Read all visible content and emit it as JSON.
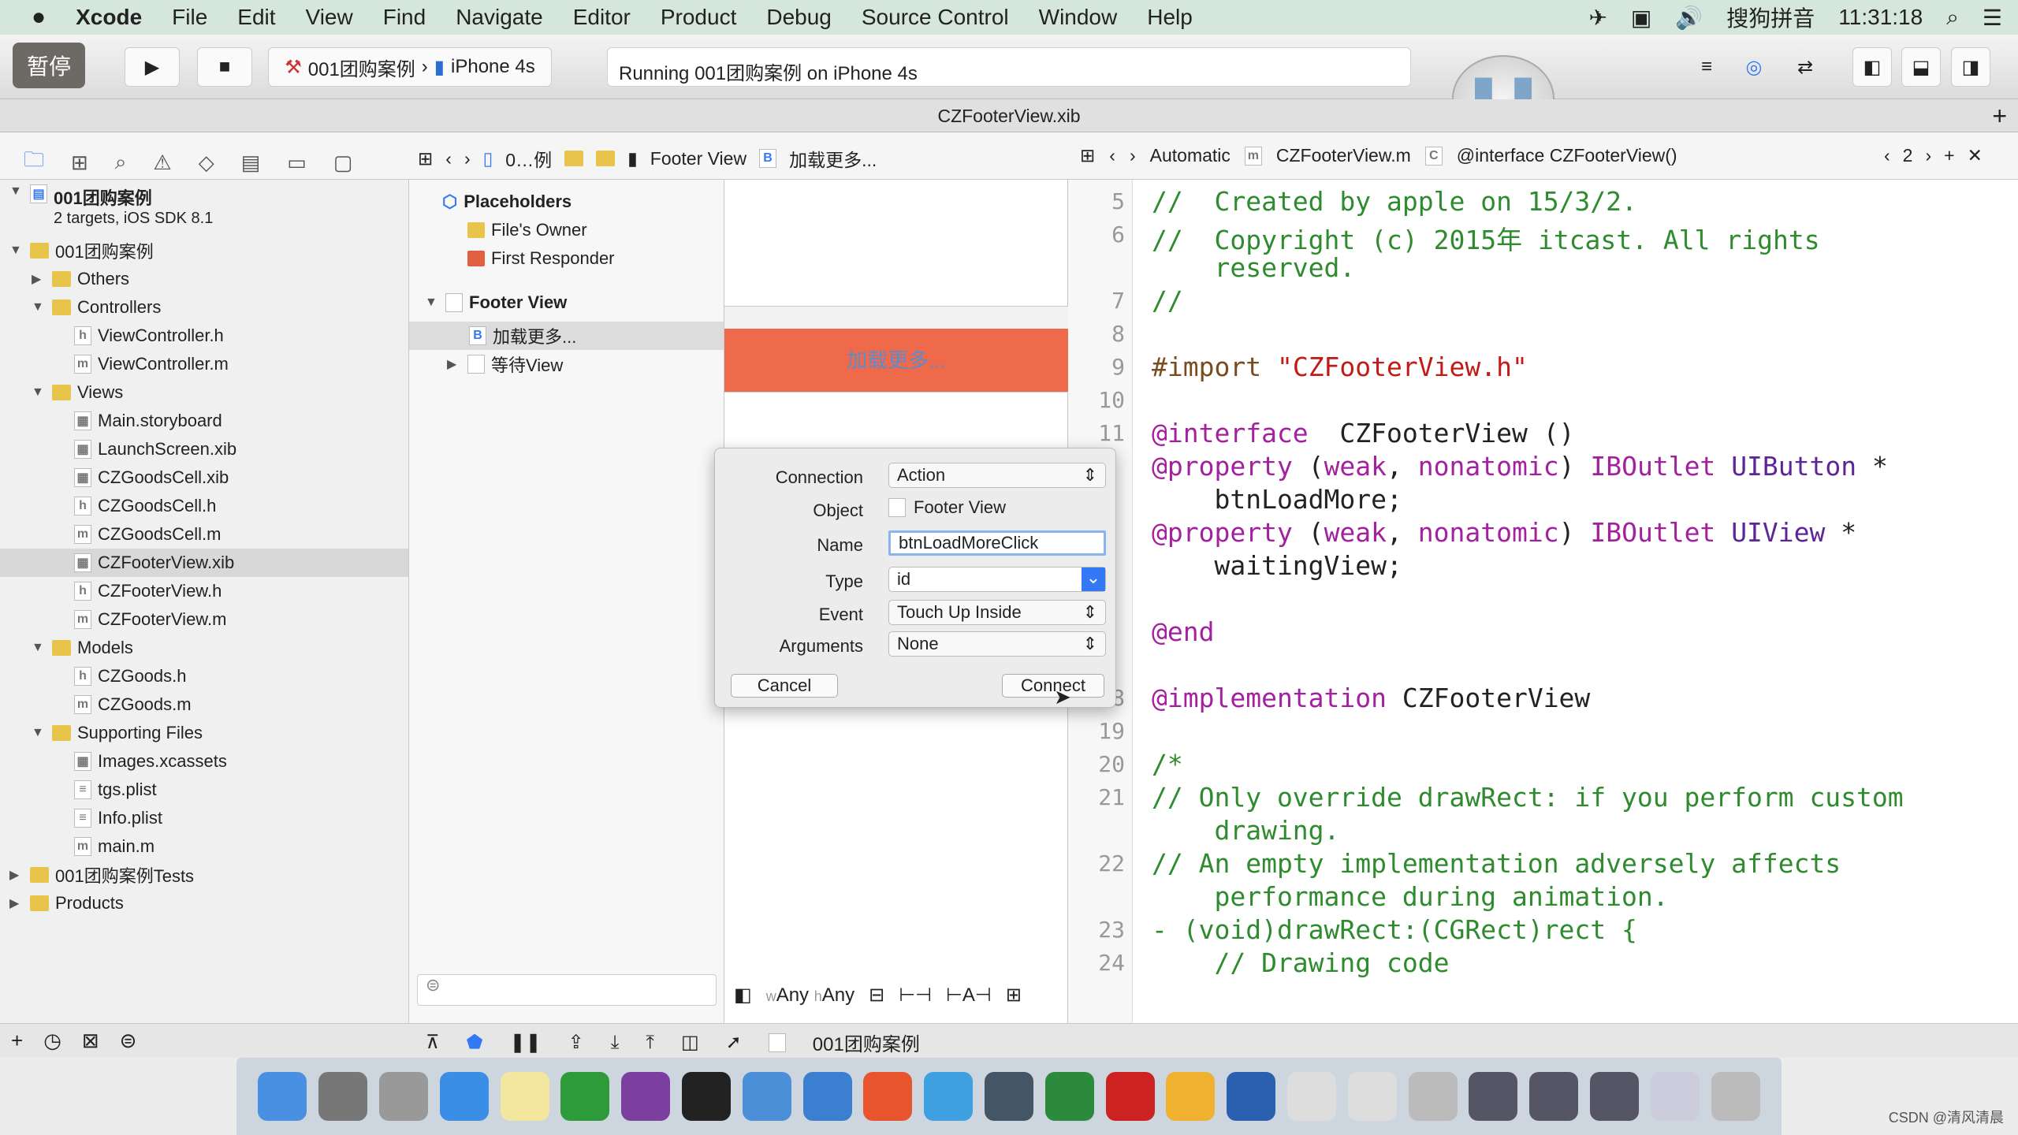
{
  "menubar": {
    "apple": "",
    "items": [
      "Xcode",
      "File",
      "Edit",
      "View",
      "Find",
      "Navigate",
      "Editor",
      "Product",
      "Debug",
      "Source Control",
      "Window",
      "Help"
    ],
    "input_method": "搜狗拼音",
    "clock": "11:31:18"
  },
  "toolbar": {
    "pause_badge": "暂停",
    "scheme": "001团购案例",
    "device": "iPhone 4s",
    "status": "Running 001团购案例 on iPhone 4s"
  },
  "tab": {
    "title": "CZFooterView.xib"
  },
  "jumpbar": {
    "crumbs": [
      "0…例",
      "Footer View",
      "加载更多..."
    ],
    "editor_mode": "Automatic",
    "file": "CZFooterView.m",
    "symbol": "@interface CZFooterView()",
    "counterpart_count": "2"
  },
  "navigator": {
    "project": "001团购案例",
    "project_sub": "2 targets, iOS SDK 8.1",
    "rows": [
      {
        "label": "001团购案例",
        "level": 1,
        "kind": "folder",
        "open": true
      },
      {
        "label": "Others",
        "level": 2,
        "kind": "folder",
        "open": false
      },
      {
        "label": "Controllers",
        "level": 2,
        "kind": "folder",
        "open": true
      },
      {
        "label": "ViewController.h",
        "level": 3,
        "kind": "h"
      },
      {
        "label": "ViewController.m",
        "level": 3,
        "kind": "m"
      },
      {
        "label": "Views",
        "level": 2,
        "kind": "folder",
        "open": true
      },
      {
        "label": "Main.storyboard",
        "level": 3,
        "kind": "sb"
      },
      {
        "label": "LaunchScreen.xib",
        "level": 3,
        "kind": "xib"
      },
      {
        "label": "CZGoodsCell.xib",
        "level": 3,
        "kind": "xib"
      },
      {
        "label": "CZGoodsCell.h",
        "level": 3,
        "kind": "h"
      },
      {
        "label": "CZGoodsCell.m",
        "level": 3,
        "kind": "m"
      },
      {
        "label": "CZFooterView.xib",
        "level": 3,
        "kind": "xib",
        "selected": true
      },
      {
        "label": "CZFooterView.h",
        "level": 3,
        "kind": "h"
      },
      {
        "label": "CZFooterView.m",
        "level": 3,
        "kind": "m"
      },
      {
        "label": "Models",
        "level": 2,
        "kind": "folder",
        "open": true
      },
      {
        "label": "CZGoods.h",
        "level": 3,
        "kind": "h"
      },
      {
        "label": "CZGoods.m",
        "level": 3,
        "kind": "m"
      },
      {
        "label": "Supporting Files",
        "level": 2,
        "kind": "folder",
        "open": true
      },
      {
        "label": "Images.xcassets",
        "level": 3,
        "kind": "xib"
      },
      {
        "label": "tgs.plist",
        "level": 3,
        "kind": "plist"
      },
      {
        "label": "Info.plist",
        "level": 3,
        "kind": "plist"
      },
      {
        "label": "main.m",
        "level": 3,
        "kind": "m"
      },
      {
        "label": "001团购案例Tests",
        "level": 1,
        "kind": "folder",
        "open": false
      },
      {
        "label": "Products",
        "level": 1,
        "kind": "folder",
        "open": false
      }
    ]
  },
  "outline": {
    "placeholders": "Placeholders",
    "files_owner": "File's Owner",
    "first_responder": "First Responder",
    "footer_view": "Footer View",
    "button": "加载更多...",
    "waiting_view": "等待View"
  },
  "canvas": {
    "button_title": "加载更多...",
    "size_w": "Any",
    "size_h": "Any",
    "w_prefix": "w",
    "h_prefix": "h"
  },
  "popup": {
    "connection_label": "Connection",
    "connection": "Action",
    "object_label": "Object",
    "object": "Footer View",
    "name_label": "Name",
    "name": "btnLoadMoreClick",
    "type_label": "Type",
    "type": "id",
    "event_label": "Event",
    "event": "Touch Up Inside",
    "arguments_label": "Arguments",
    "arguments": "None",
    "cancel": "Cancel",
    "connect": "Connect"
  },
  "code": [
    {
      "n": "5",
      "parts": [
        [
          "c-com",
          "//  Created by apple on 15/3/2."
        ]
      ]
    },
    {
      "n": "6",
      "parts": [
        [
          "c-com",
          "//  Copyright (c) 2015年 itcast. All rights"
        ]
      ]
    },
    {
      "n": "",
      "parts": [
        [
          "c-com",
          "    reserved."
        ]
      ]
    },
    {
      "n": "7",
      "parts": [
        [
          "c-com",
          "//"
        ]
      ]
    },
    {
      "n": "8",
      "parts": []
    },
    {
      "n": "9",
      "parts": [
        [
          "c-pp",
          "#import "
        ],
        [
          "c-str",
          "\"CZFooterView.h\""
        ]
      ]
    },
    {
      "n": "10",
      "parts": []
    },
    {
      "n": "11",
      "parts": [
        [
          "c-kw",
          "@interface"
        ],
        [
          "",
          "  CZFooterView ()"
        ]
      ]
    },
    {
      "n": "",
      "parts": [
        [
          "c-kw",
          "@property"
        ],
        [
          "",
          " ("
        ],
        [
          "c-kw",
          "weak"
        ],
        [
          "",
          ", "
        ],
        [
          "c-kw",
          "nonatomic"
        ],
        [
          "",
          ") "
        ],
        [
          "c-kw",
          "IBOutlet"
        ],
        [
          "",
          " "
        ],
        [
          "c-cls",
          "UIButton"
        ],
        [
          "",
          " *"
        ]
      ]
    },
    {
      "n": "",
      "parts": [
        [
          "",
          "    btnLoadMore;"
        ]
      ]
    },
    {
      "n": "",
      "parts": [
        [
          "c-kw",
          "@property"
        ],
        [
          "",
          " ("
        ],
        [
          "c-kw",
          "weak"
        ],
        [
          "",
          ", "
        ],
        [
          "c-kw",
          "nonatomic"
        ],
        [
          "",
          ") "
        ],
        [
          "c-kw",
          "IBOutlet"
        ],
        [
          "",
          " "
        ],
        [
          "c-cls",
          "UIView"
        ],
        [
          "",
          " *"
        ]
      ]
    },
    {
      "n": "",
      "parts": [
        [
          "",
          "    waitingView;"
        ]
      ]
    },
    {
      "n": "",
      "parts": []
    },
    {
      "n": "",
      "parts": [
        [
          "c-kw",
          "@end"
        ]
      ]
    },
    {
      "n": "",
      "parts": []
    },
    {
      "n": "18",
      "parts": [
        [
          "c-kw",
          "@implementation"
        ],
        [
          "",
          " CZFooterView"
        ]
      ]
    },
    {
      "n": "19",
      "parts": []
    },
    {
      "n": "20",
      "parts": [
        [
          "c-com",
          "/*"
        ]
      ]
    },
    {
      "n": "21",
      "parts": [
        [
          "c-com",
          "// Only override drawRect: if you perform custom"
        ]
      ]
    },
    {
      "n": "",
      "parts": [
        [
          "c-com",
          "    drawing."
        ]
      ]
    },
    {
      "n": "22",
      "parts": [
        [
          "c-com",
          "// An empty implementation adversely affects"
        ]
      ]
    },
    {
      "n": "",
      "parts": [
        [
          "c-com",
          "    performance during animation."
        ]
      ]
    },
    {
      "n": "23",
      "parts": [
        [
          "c-com",
          "- (void)drawRect:(CGRect)rect {"
        ]
      ]
    },
    {
      "n": "24",
      "parts": [
        [
          "c-com",
          "    // Drawing code"
        ]
      ]
    }
  ],
  "bottombar": {
    "scheme": "001团购案例"
  },
  "watermark": "CSDN @清风清晨",
  "colors": {
    "accent": "#3478f6",
    "button_bg": "#ef6a4a",
    "comment": "#2e8b2e",
    "keyword": "#a3219e"
  }
}
